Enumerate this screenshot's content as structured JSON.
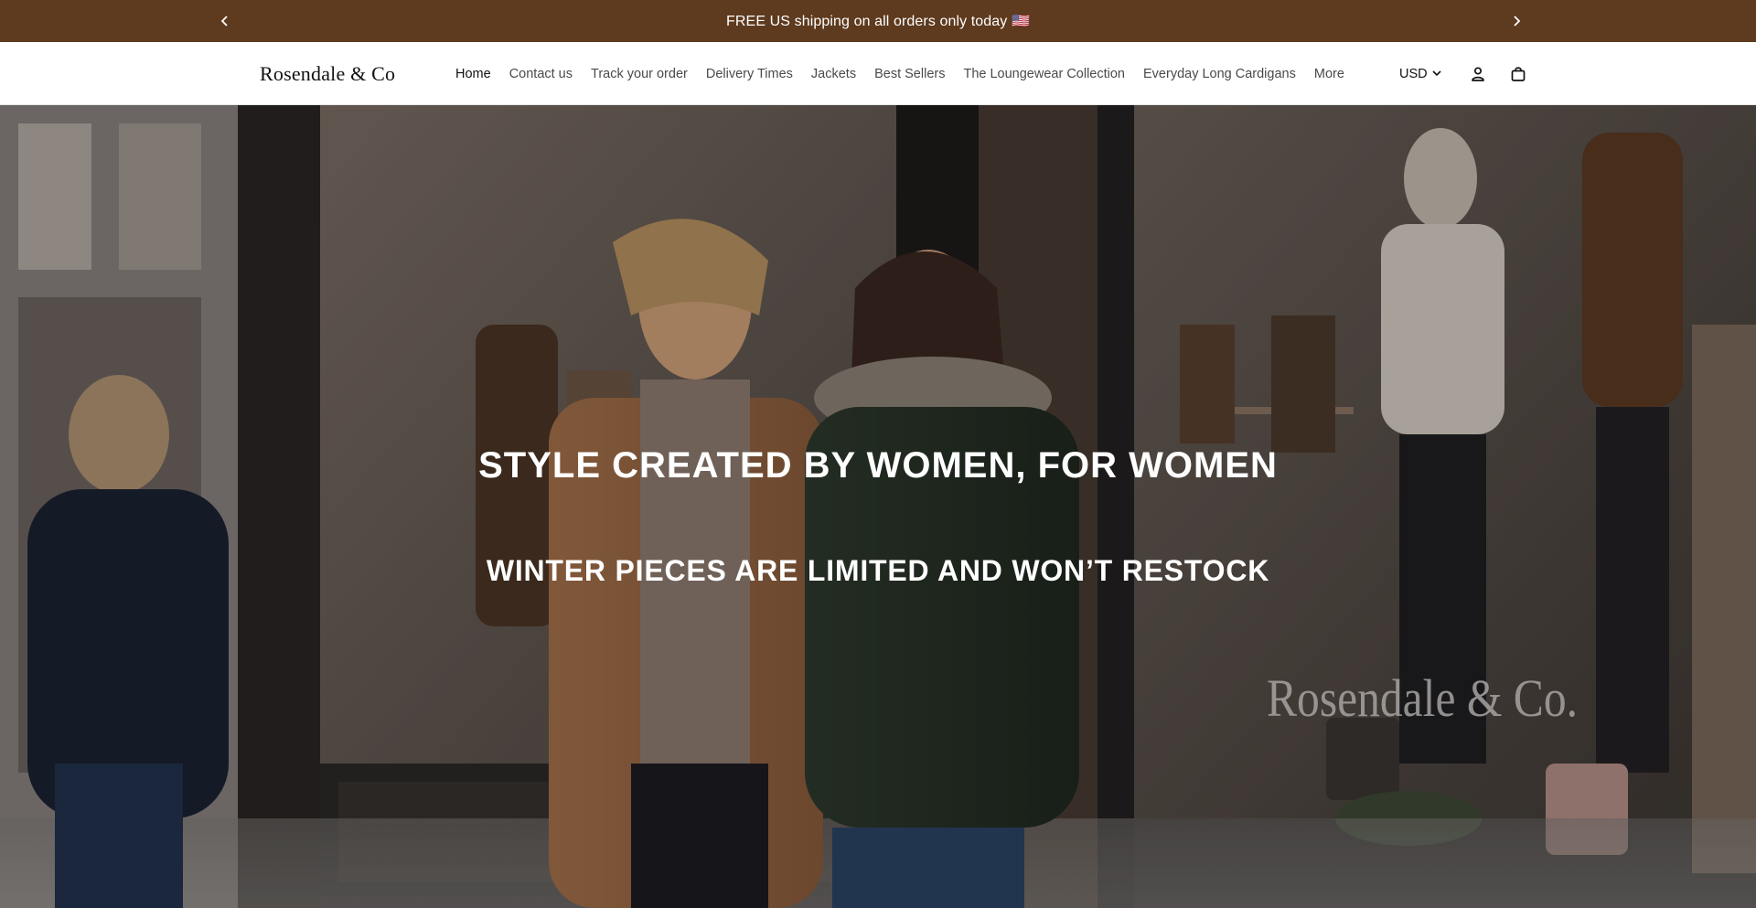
{
  "announcement": {
    "text": "FREE US shipping on all orders only today 🇺🇸",
    "prev_icon": "chevron-left-icon",
    "next_icon": "chevron-right-icon"
  },
  "header": {
    "logo_text": "Rosendale & Co",
    "nav": [
      {
        "label": "Home",
        "active": true
      },
      {
        "label": "Contact us",
        "active": false
      },
      {
        "label": "Track your order",
        "active": false
      },
      {
        "label": "Delivery Times",
        "active": false
      },
      {
        "label": "Jackets",
        "active": false
      },
      {
        "label": "Best Sellers",
        "active": false
      },
      {
        "label": "The Loungewear Collection",
        "active": false
      },
      {
        "label": "Everyday Long Cardigans",
        "active": false
      },
      {
        "label": "More",
        "active": false
      }
    ],
    "currency": "USD",
    "icons": [
      "chevron-down-icon",
      "account-icon",
      "cart-icon"
    ]
  },
  "hero": {
    "title": "STYLE CREATED BY WOMEN, FOR WOMEN",
    "subtitle": "WINTER PIECES ARE LIMITED AND WON’T RESTOCK",
    "storefront_sign": "Rosendale & Co."
  },
  "colors": {
    "announcement_bg": "#5e3a1e",
    "header_bg": "#ffffff",
    "hero_text": "#ffffff"
  }
}
